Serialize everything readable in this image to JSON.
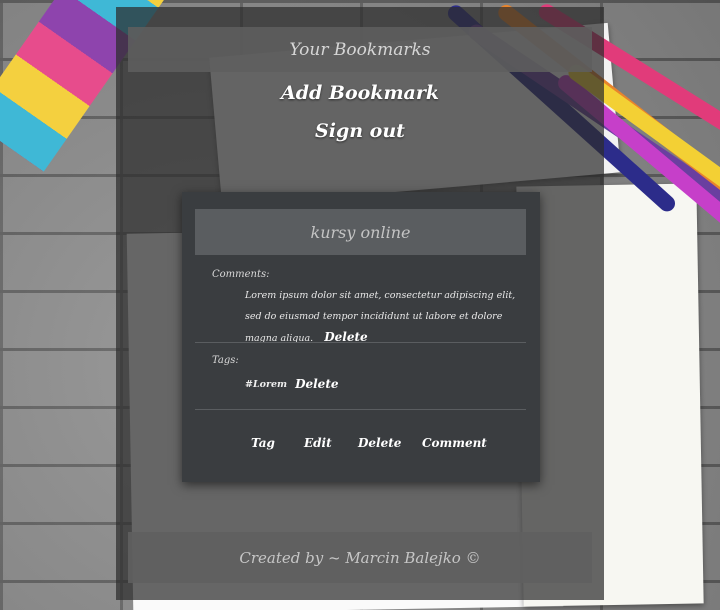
{
  "header": {
    "title": "Your Bookmarks"
  },
  "nav": {
    "add_bookmark": "Add Bookmark",
    "sign_out": "Sign out"
  },
  "card": {
    "title": "kursy online",
    "comments_label": "Comments:",
    "comment_text": "Lorem ipsum dolor sit amet, consectetur adipiscing elit, sed do eiusmod tempor incididunt ut labore et dolore magna aliqua.",
    "comment_delete": "Delete",
    "tags_label": "Tags:",
    "tag": "#Lorem",
    "tag_delete": "Delete",
    "actions": {
      "tag": "Tag",
      "edit": "Edit",
      "delete": "Delete",
      "comment": "Comment"
    }
  },
  "footer": {
    "text": "Created by ~ Marcin Balejko ©"
  }
}
